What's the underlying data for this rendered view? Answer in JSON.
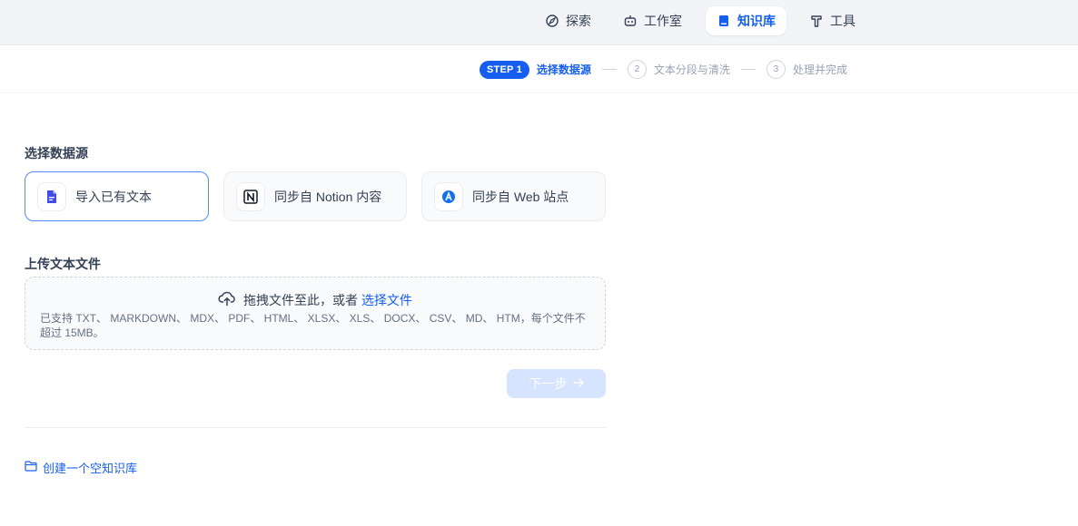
{
  "nav": {
    "items": [
      {
        "label": "探索",
        "icon": "compass-icon"
      },
      {
        "label": "工作室",
        "icon": "robot-icon"
      },
      {
        "label": "知识库",
        "icon": "book-icon",
        "active": true
      },
      {
        "label": "工具",
        "icon": "hammer-icon"
      }
    ]
  },
  "steps": {
    "active_badge": "STEP 1",
    "active_label": "选择数据源",
    "step2_num": "2",
    "step2_label": "文本分段与清洗",
    "step3_num": "3",
    "step3_label": "处理并完成"
  },
  "datasource": {
    "title": "选择数据源",
    "options": [
      {
        "label": "导入已有文本",
        "icon": "document-icon",
        "selected": true
      },
      {
        "label": "同步自 Notion 内容",
        "icon": "notion-icon",
        "selected": false
      },
      {
        "label": "同步自 Web 站点",
        "icon": "web-icon",
        "selected": false
      }
    ]
  },
  "upload": {
    "title": "上传文本文件",
    "drag_text": "拖拽文件至此，或者",
    "select_link": "选择文件",
    "hint": "已支持 TXT、 MARKDOWN、 MDX、 PDF、 HTML、 XLSX、 XLS、 DOCX、 CSV、 MD、 HTM，每个文件不超过 15MB。"
  },
  "next_button": "下一步",
  "create_empty": "创建一个空知识库",
  "colors": {
    "accent": "#155eef",
    "disabled_button": "#d6e4ff"
  }
}
